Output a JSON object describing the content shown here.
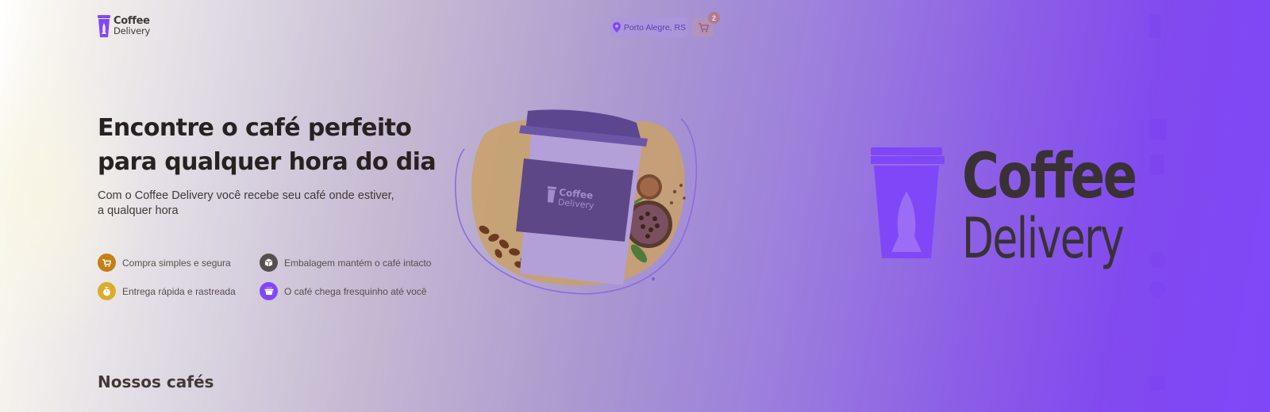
{
  "header": {
    "logo_line1": "Coffee",
    "logo_line2": "Delivery",
    "location": "Porto Alegre, RS",
    "cart_count": "2"
  },
  "hero": {
    "title": "Encontre o café perfeito para qualquer hora do dia",
    "subtitle": "Com o Coffee Delivery você recebe seu café onde estiver, a qualquer hora",
    "features": [
      {
        "label": "Compra simples e segura",
        "icon": "cart-icon",
        "color": "#c47f17"
      },
      {
        "label": "Embalagem mantém o café intacto",
        "icon": "package-icon",
        "color": "#574f4d"
      },
      {
        "label": "Entrega rápida e rastreada",
        "icon": "timer-icon",
        "color": "#dbac2c"
      },
      {
        "label": "O café chega fresquinho até você",
        "icon": "coffee-icon",
        "color": "#8047f8"
      }
    ],
    "cup_logo_line1": "Coffee",
    "cup_logo_line2": "Delivery"
  },
  "section": {
    "title": "Nossos cafés"
  },
  "brand": {
    "line1": "Coffee",
    "line2": "Delivery"
  },
  "colors": {
    "accent_purple": "#8047f8",
    "yellow_dark": "#c47f17",
    "yellow": "#dbac2c",
    "base_text": "#403937"
  }
}
